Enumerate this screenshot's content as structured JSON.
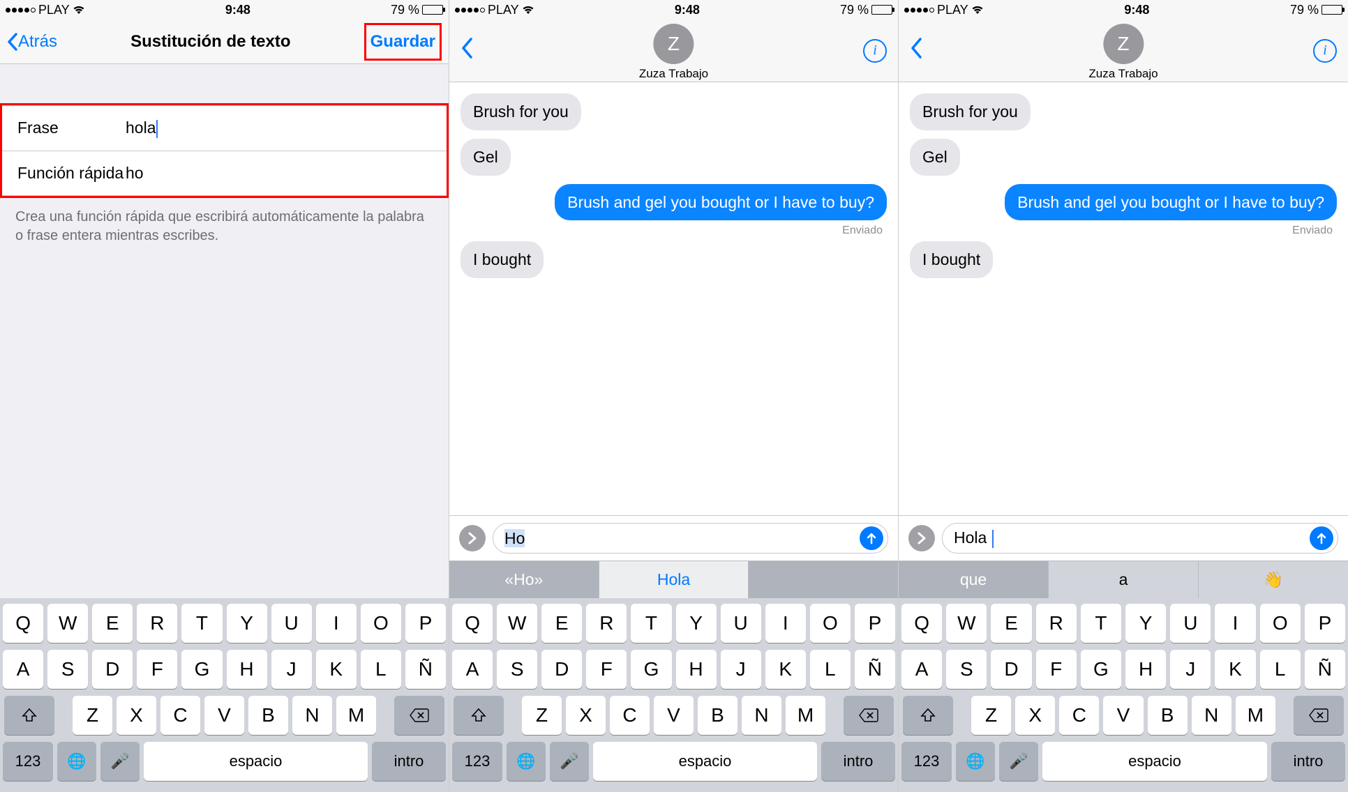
{
  "status": {
    "carrier": "PLAY",
    "time": "9:48",
    "battery_pct": "79 %"
  },
  "screen1": {
    "nav_back": "Atrás",
    "nav_title": "Sustitución de texto",
    "nav_save": "Guardar",
    "field_phrase_label": "Frase",
    "field_phrase_value": "hola",
    "field_shortcut_label": "Función rápida",
    "field_shortcut_value": "ho",
    "hint": "Crea una función rápida que escribirá automáticamente la palabra o frase entera mientras escribes."
  },
  "screen2": {
    "contact_initial": "Z",
    "contact_name": "Zuza Trabajo",
    "msg1": "Brush for you",
    "msg2": "Gel",
    "msg3": "Brush and gel you bought or I have to buy?",
    "msg_status": "Enviado",
    "msg4": "I bought",
    "input_value": "Ho",
    "suggest1": "«Ho»",
    "suggest2": "Hola",
    "suggest3": ""
  },
  "screen3": {
    "contact_initial": "Z",
    "contact_name": "Zuza Trabajo",
    "msg1": "Brush for you",
    "msg2": "Gel",
    "msg3": "Brush and gel you bought or I have to buy?",
    "msg_status": "Enviado",
    "msg4": "I bought",
    "input_value": "Hola ",
    "suggest1": "que",
    "suggest2": "a",
    "suggest3": "👋"
  },
  "keyboard": {
    "row1": [
      "Q",
      "W",
      "E",
      "R",
      "T",
      "Y",
      "U",
      "I",
      "O",
      "P"
    ],
    "row2": [
      "A",
      "S",
      "D",
      "F",
      "G",
      "H",
      "J",
      "K",
      "L",
      "Ñ"
    ],
    "row3": [
      "Z",
      "X",
      "C",
      "V",
      "B",
      "N",
      "M"
    ],
    "num": "123",
    "space": "espacio",
    "enter": "intro"
  }
}
